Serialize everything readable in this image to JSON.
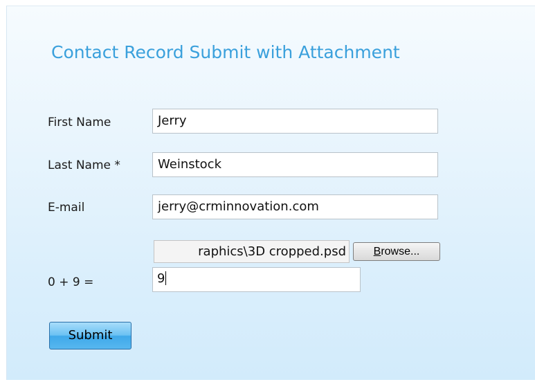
{
  "form": {
    "title": "Contact Record Submit with Attachment",
    "first_name": {
      "label": "First Name",
      "value": "Jerry"
    },
    "last_name": {
      "label": "Last Name *",
      "value": "Weinstock"
    },
    "email": {
      "label": "E-mail",
      "value": "jerry@crminnovation.com"
    },
    "attachment": {
      "value": "raphics\\3D cropped.psd",
      "browse_label": "Browse...",
      "browse_underlined": "B",
      "browse_rest": "rowse..."
    },
    "captcha": {
      "label": "0 + 9 =",
      "value": "9"
    },
    "submit_label": "Submit"
  },
  "colors": {
    "title": "#3aa0dc",
    "panel_top": "#f6fbfe",
    "panel_bottom": "#d2ebfb",
    "submit_button": "#57b7ef"
  }
}
